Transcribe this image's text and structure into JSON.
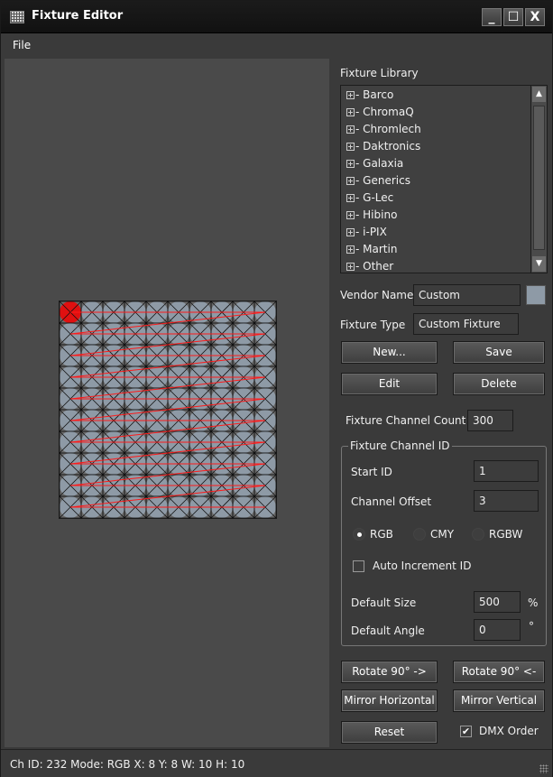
{
  "window": {
    "title": "Fixture Editor",
    "minimize": "_",
    "maximize": "☐",
    "close": "X"
  },
  "menu": {
    "file": "File"
  },
  "library": {
    "title": "Fixture Library",
    "items": [
      "Barco",
      "ChromaQ",
      "Chromlech",
      "Daktronics",
      "Galaxia",
      "Generics",
      "G-Lec",
      "Hibino",
      "i-PIX",
      "Martin",
      "Other"
    ]
  },
  "vendor": {
    "label": "Vendor Name",
    "value": "Custom"
  },
  "fixture_type": {
    "label": "Fixture Type",
    "value": "Custom Fixture"
  },
  "buttons": {
    "new": "New...",
    "save": "Save",
    "edit": "Edit",
    "delete": "Delete",
    "rotate_cw": "Rotate 90° ->",
    "rotate_ccw": "Rotate 90° <-",
    "mirror_h": "Mirror Horizontal",
    "mirror_v": "Mirror Vertical",
    "reset": "Reset"
  },
  "channel_count": {
    "label": "Fixture Channel Count",
    "value": "300"
  },
  "channel_id": {
    "title": "Fixture Channel ID",
    "start_label": "Start ID",
    "start_value": "1",
    "offset_label": "Channel Offset",
    "offset_value": "3",
    "modes": [
      "RGB",
      "CMY",
      "RGBW"
    ],
    "auto_increment": "Auto Increment ID",
    "size_label": "Default Size",
    "size_value": "500",
    "size_unit": "%",
    "angle_label": "Default Angle",
    "angle_value": "0",
    "angle_unit": "°"
  },
  "dmx_order": {
    "label": "DMX Order",
    "checked": "✔"
  },
  "grid": {
    "columns": 10,
    "rows": 10,
    "cell_color": "#8e9aa6",
    "selected_color": "#e01010",
    "path_color": "#ff1a1a"
  },
  "status": {
    "text": "Ch ID: 232  Mode: RGB  X: 8  Y: 8  W: 10  H: 10"
  }
}
